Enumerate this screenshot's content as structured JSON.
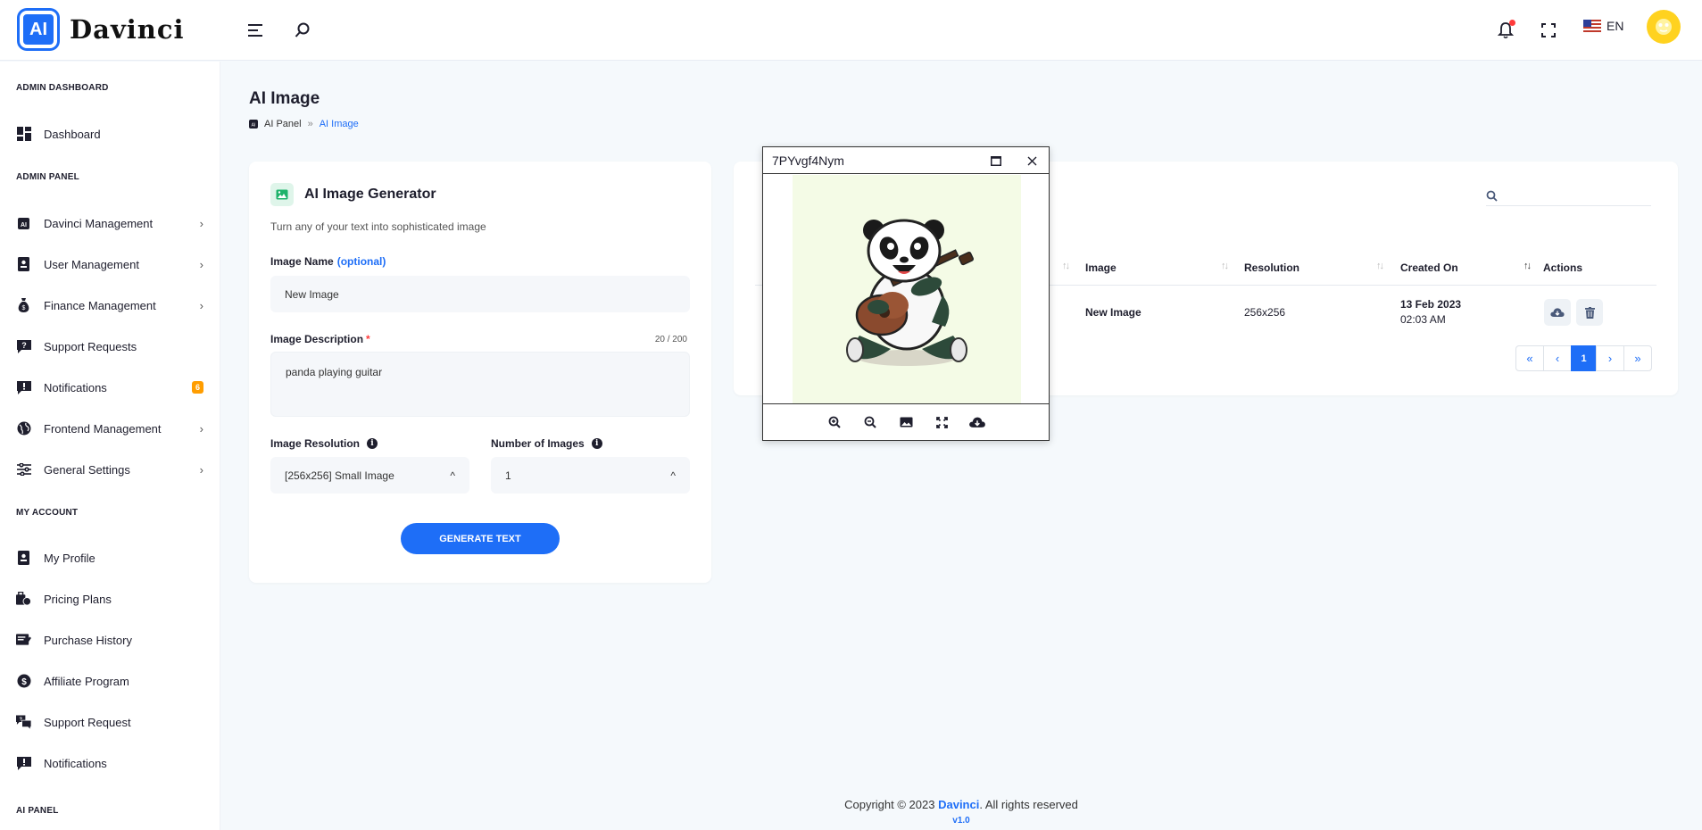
{
  "header": {
    "logo_chip": "AI",
    "logo_text": "Davinci",
    "language": "EN"
  },
  "sidebar": {
    "sections": [
      {
        "heading": "ADMIN DASHBOARD"
      },
      {
        "heading": "ADMIN PANEL"
      },
      {
        "heading": "MY ACCOUNT"
      },
      {
        "heading": "AI PANEL"
      }
    ],
    "items": [
      {
        "label": "Dashboard",
        "icon": "dashboard-icon"
      },
      {
        "label": "Davinci Management",
        "icon": "ai-chip-icon",
        "has_children": true
      },
      {
        "label": "User Management",
        "icon": "user-badge-icon",
        "has_children": true
      },
      {
        "label": "Finance Management",
        "icon": "money-bag-icon",
        "has_children": true
      },
      {
        "label": "Support Requests",
        "icon": "question-bubble-icon"
      },
      {
        "label": "Notifications",
        "icon": "alert-bubble-icon",
        "badge": "6"
      },
      {
        "label": "Frontend Management",
        "icon": "globe-icon",
        "has_children": true
      },
      {
        "label": "General Settings",
        "icon": "sliders-icon",
        "has_children": true
      },
      {
        "label": "My Profile",
        "icon": "user-badge-icon"
      },
      {
        "label": "Pricing Plans",
        "icon": "pricing-icon"
      },
      {
        "label": "Purchase History",
        "icon": "history-icon"
      },
      {
        "label": "Affiliate Program",
        "icon": "dollar-coin-icon"
      },
      {
        "label": "Support Request",
        "icon": "chat-question-icon"
      },
      {
        "label": "Notifications",
        "icon": "alert-bubble-icon"
      }
    ]
  },
  "page": {
    "title": "AI Image",
    "breadcrumb": [
      "AI Panel",
      "AI Image"
    ]
  },
  "generator": {
    "title": "AI Image Generator",
    "subtitle": "Turn any of your text into sophisticated image",
    "name_label": "Image Name",
    "name_optional": "(optional)",
    "name_value": "New Image",
    "desc_label": "Image Description",
    "desc_required": "*",
    "desc_counter": "20 / 200",
    "desc_value": "panda playing guitar",
    "resolution_label": "Image Resolution",
    "resolution_value": "[256x256] Small Image",
    "count_label": "Number of Images",
    "count_value": "1",
    "button": "GENERATE TEXT"
  },
  "table": {
    "columns": [
      "Image",
      "Resolution",
      "Created On",
      "Actions"
    ],
    "rows": [
      {
        "name": "New Image",
        "resolution": "256x256",
        "date": "13 Feb 2023",
        "time": "02:03 AM"
      }
    ],
    "pager": {
      "first": "«",
      "prev": "‹",
      "current": "1",
      "next": "›",
      "last": "»"
    }
  },
  "viewer": {
    "title": "7PYvgf4Nym",
    "tools": [
      "zoom-in-icon",
      "zoom-out-icon",
      "image-icon",
      "fullscreen-icon",
      "cloud-download-icon"
    ]
  },
  "footer": {
    "copyright_prefix": "Copyright © 2023 ",
    "brand": "Davinci",
    "copyright_suffix": ". All rights reserved",
    "version": "v1.0"
  },
  "colors": {
    "accent": "#1e6ef7",
    "badge": "#ff9d00",
    "notification_dot": "#ff3b3b",
    "avatar": "#ffd21f"
  }
}
